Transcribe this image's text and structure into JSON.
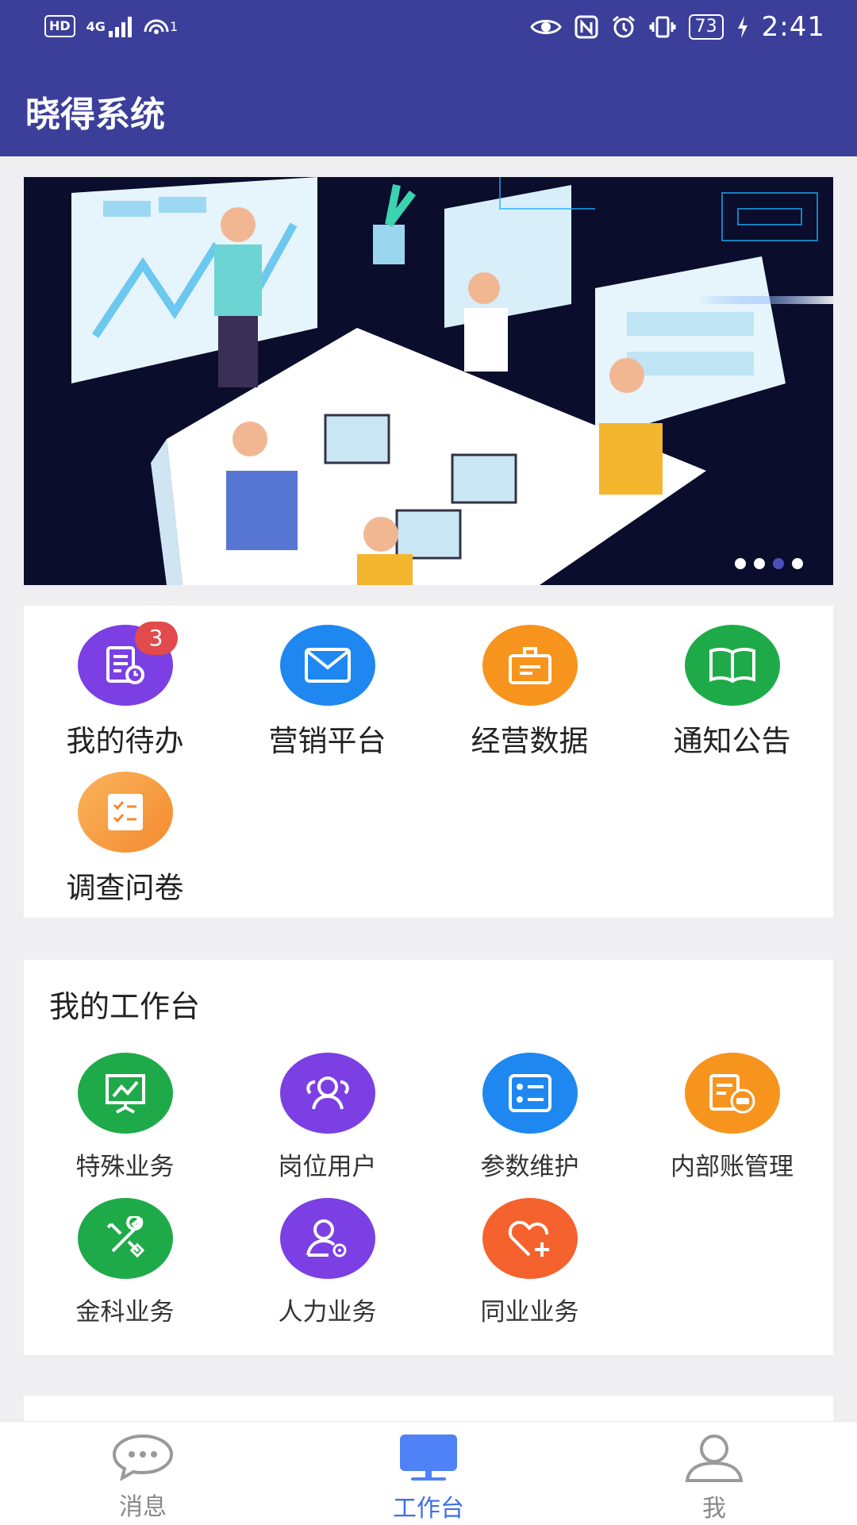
{
  "status_bar": {
    "hd": "HD",
    "network": "4G",
    "hotspot_count": "1",
    "battery": "73",
    "time": "2:41"
  },
  "app": {
    "title": "晓得系统"
  },
  "banner": {
    "page_count": 4,
    "active_index": 2
  },
  "quick_actions": [
    {
      "label": "我的待办",
      "icon": "todo-clock-icon",
      "color": "#7b3fe4",
      "badge": "3"
    },
    {
      "label": "营销平台",
      "icon": "mail-icon",
      "color": "#1e88f0"
    },
    {
      "label": "经营数据",
      "icon": "briefcase-icon",
      "color": "#f7941d"
    },
    {
      "label": "通知公告",
      "icon": "open-book-icon",
      "color": "#1faa4a"
    },
    {
      "label": "调查问卷",
      "icon": "checklist-icon",
      "color": "#f79a3c"
    }
  ],
  "workbench": {
    "title": "我的工作台",
    "items": [
      {
        "label": "特殊业务",
        "icon": "presentation-board-icon",
        "color": "#1faa4a"
      },
      {
        "label": "岗位用户",
        "icon": "group-users-icon",
        "color": "#7b3fe4"
      },
      {
        "label": "参数维护",
        "icon": "checklist-settings-icon",
        "color": "#1e88f0"
      },
      {
        "label": "内部账管理",
        "icon": "ledger-car-icon",
        "color": "#f7941d"
      },
      {
        "label": "金科业务",
        "icon": "tools-icon",
        "color": "#1faa4a"
      },
      {
        "label": "人力业务",
        "icon": "user-gear-icon",
        "color": "#7b3fe4"
      },
      {
        "label": "同业业务",
        "icon": "heart-plus-icon",
        "color": "#f5622d"
      }
    ]
  },
  "bottom_nav": [
    {
      "label": "消息",
      "icon": "chat-bubble-icon",
      "active": false
    },
    {
      "label": "工作台",
      "icon": "monitor-icon",
      "active": true
    },
    {
      "label": "我",
      "icon": "user-icon",
      "active": false
    }
  ],
  "colors": {
    "header": "#3b3f9a",
    "active_nav": "#3f6fe6"
  }
}
